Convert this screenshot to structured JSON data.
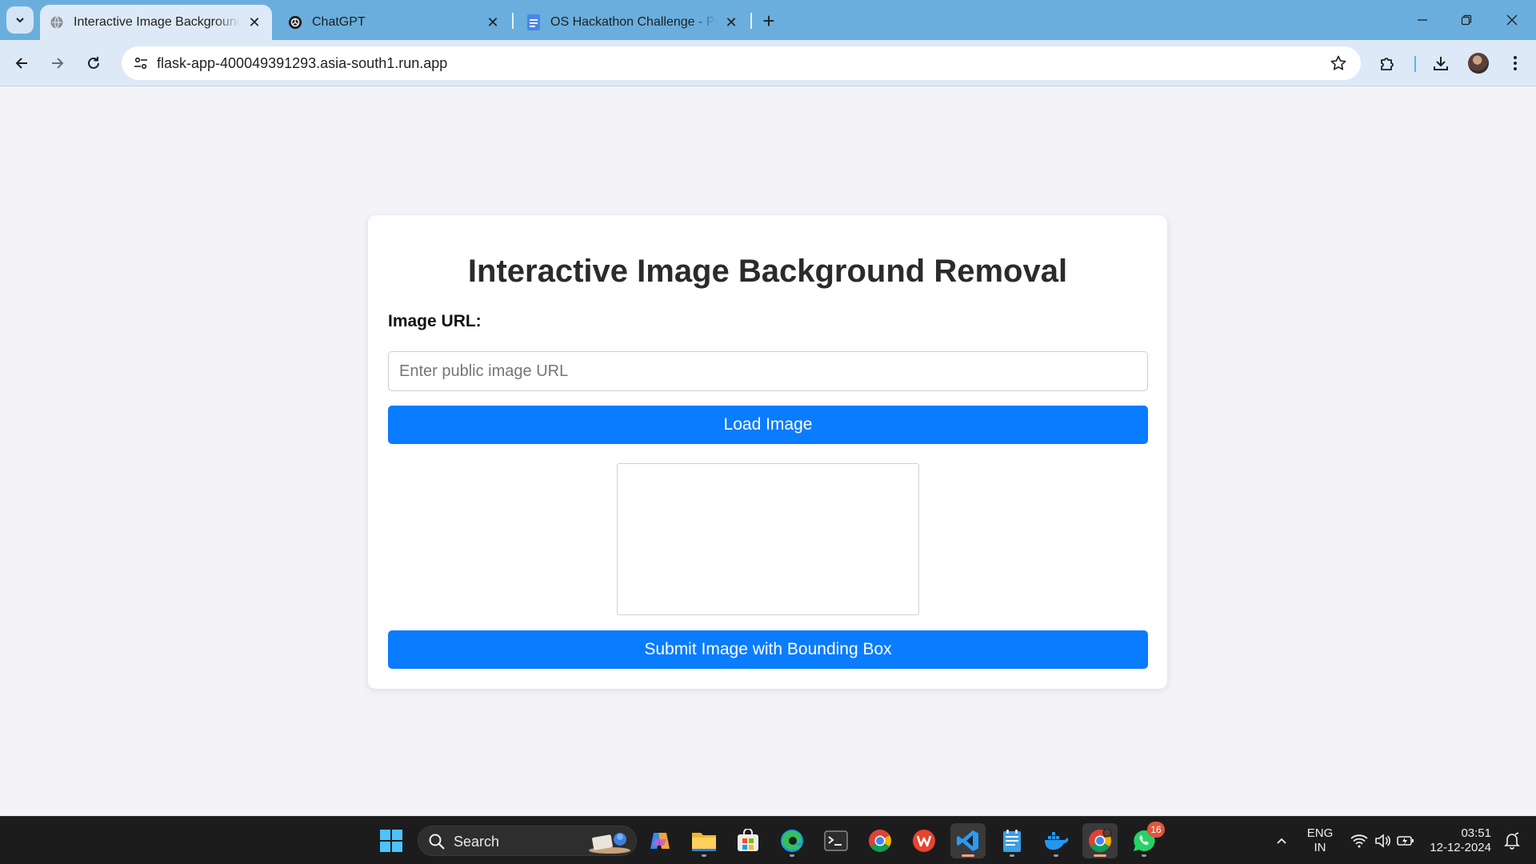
{
  "browser": {
    "tabs": [
      {
        "title": "Interactive Image Background Removal",
        "active": true,
        "favicon": "globe-icon"
      },
      {
        "title": "ChatGPT",
        "active": false,
        "favicon": "openai-icon"
      },
      {
        "title": "OS Hackathon Challenge - Pre-Hackathon",
        "active": false,
        "favicon": "google-docs-icon"
      }
    ],
    "url": "flask-app-400049391293.asia-south1.run.app"
  },
  "page": {
    "heading": "Interactive Image Background Removal",
    "image_url_label": "Image URL:",
    "image_url_value": "",
    "image_url_placeholder": "Enter public image URL",
    "load_button": "Load Image",
    "submit_button": "Submit Image with Bounding Box",
    "accent_color": "#0a7cff"
  },
  "taskbar": {
    "search_label": "Search",
    "apps": [
      "windows-start",
      "copilot",
      "file-explorer",
      "microsoft-store",
      "edge",
      "terminal",
      "chrome",
      "wps-office",
      "vscode",
      "notepad",
      "docker",
      "chrome-profile",
      "whatsapp"
    ],
    "whatsapp_badge": "16",
    "language_line1": "ENG",
    "language_line2": "IN",
    "time": "03:51",
    "date": "12-12-2024"
  }
}
